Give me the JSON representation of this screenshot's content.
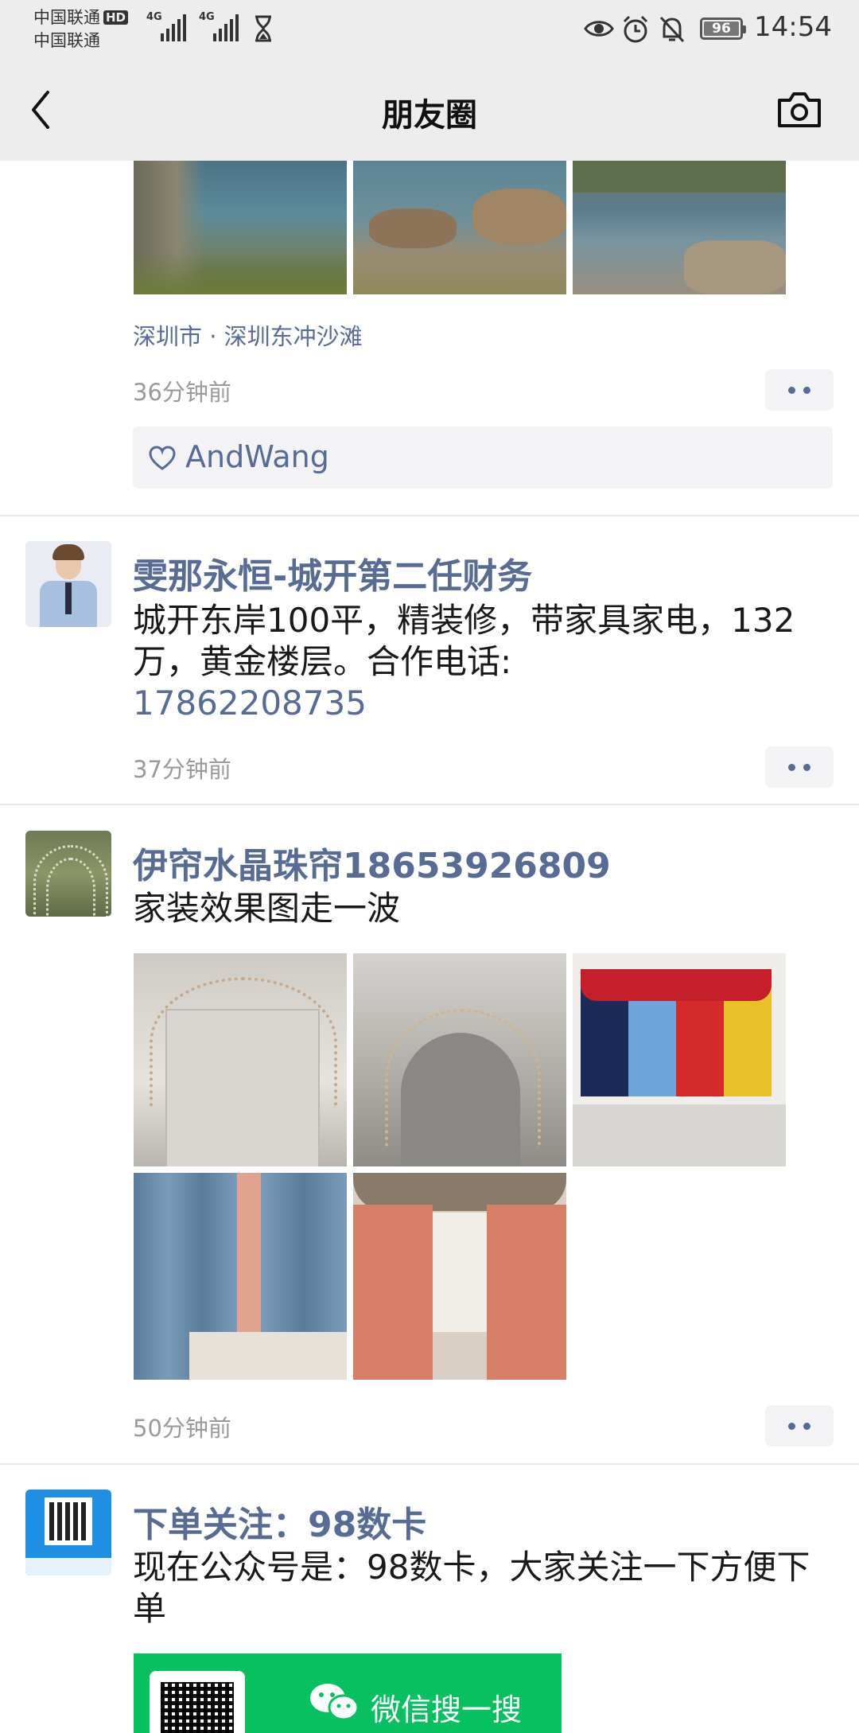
{
  "status_bar": {
    "carrier1": "中国联通",
    "hd_badge": "HD",
    "carrier2": "中国联通",
    "network1": "4G",
    "network2": "4G",
    "battery": "96",
    "time": "14:54"
  },
  "nav": {
    "title": "朋友圈"
  },
  "posts": [
    {
      "location": "深圳市 · 深圳东冲沙滩",
      "time": "36分钟前",
      "likes": "AndWang"
    },
    {
      "author": "雯那永恒-城开第二任财务",
      "text": "城开东岸100平，精装修，带家具家电，132万，黄金楼层。合作电话:",
      "phone": "17862208735",
      "time": "37分钟前"
    },
    {
      "author": "伊帘水晶珠帘18653926809",
      "text": "家装效果图走一波",
      "time": "50分钟前"
    },
    {
      "author": "下单关注：98数卡",
      "text": "现在公众号是：98数卡，大家关注一下方便下单",
      "card_text": "微信搜一搜"
    }
  ],
  "colors": {
    "link": "#576b95",
    "wechat_green": "#07c160",
    "bar_bg": "#ededed"
  }
}
